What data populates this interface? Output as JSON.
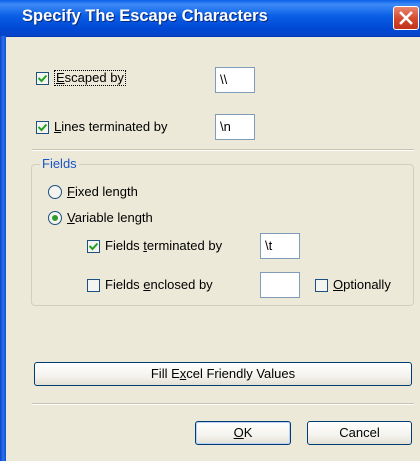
{
  "dialog": {
    "title": "Specify The Escape Characters"
  },
  "escaped_by": {
    "prefix": "",
    "accel": "E",
    "rest": "scaped by",
    "checked": true,
    "value": "\\\\"
  },
  "lines_terminated": {
    "prefix": "",
    "accel": "L",
    "rest": "ines terminated by",
    "checked": true,
    "value": "\\n"
  },
  "fields": {
    "legend": "Fields",
    "fixed": {
      "prefix": "",
      "accel": "F",
      "rest": "ixed length",
      "selected": false
    },
    "variable": {
      "prefix": "",
      "accel": "V",
      "rest": "ariable length",
      "selected": true
    },
    "terminated": {
      "prefix": "Fields ",
      "accel": "t",
      "rest": "erminated by",
      "checked": true,
      "value": "\\t"
    },
    "enclosed": {
      "prefix": "Fields ",
      "accel": "e",
      "rest": "nclosed by",
      "checked": false,
      "value": ""
    },
    "optionally": {
      "prefix": "",
      "accel": "O",
      "rest": "ptionally",
      "checked": false
    }
  },
  "buttons": {
    "fill_excel": {
      "prefix": "Fill E",
      "accel": "x",
      "rest": "cel Friendly Values"
    },
    "ok": {
      "prefix": "",
      "accel": "O",
      "rest": "K"
    },
    "cancel": {
      "prefix": "Cancel",
      "accel": "",
      "rest": ""
    }
  },
  "icons": {
    "close": "close-icon",
    "check": "checkmark-icon",
    "radio": "radio-dot"
  },
  "colors": {
    "title_bar": "#0A5EE6",
    "face": "#ECE9D8",
    "legend_text": "#1A54C8",
    "check_green": "#21A121",
    "close_red": "#D4482D"
  }
}
